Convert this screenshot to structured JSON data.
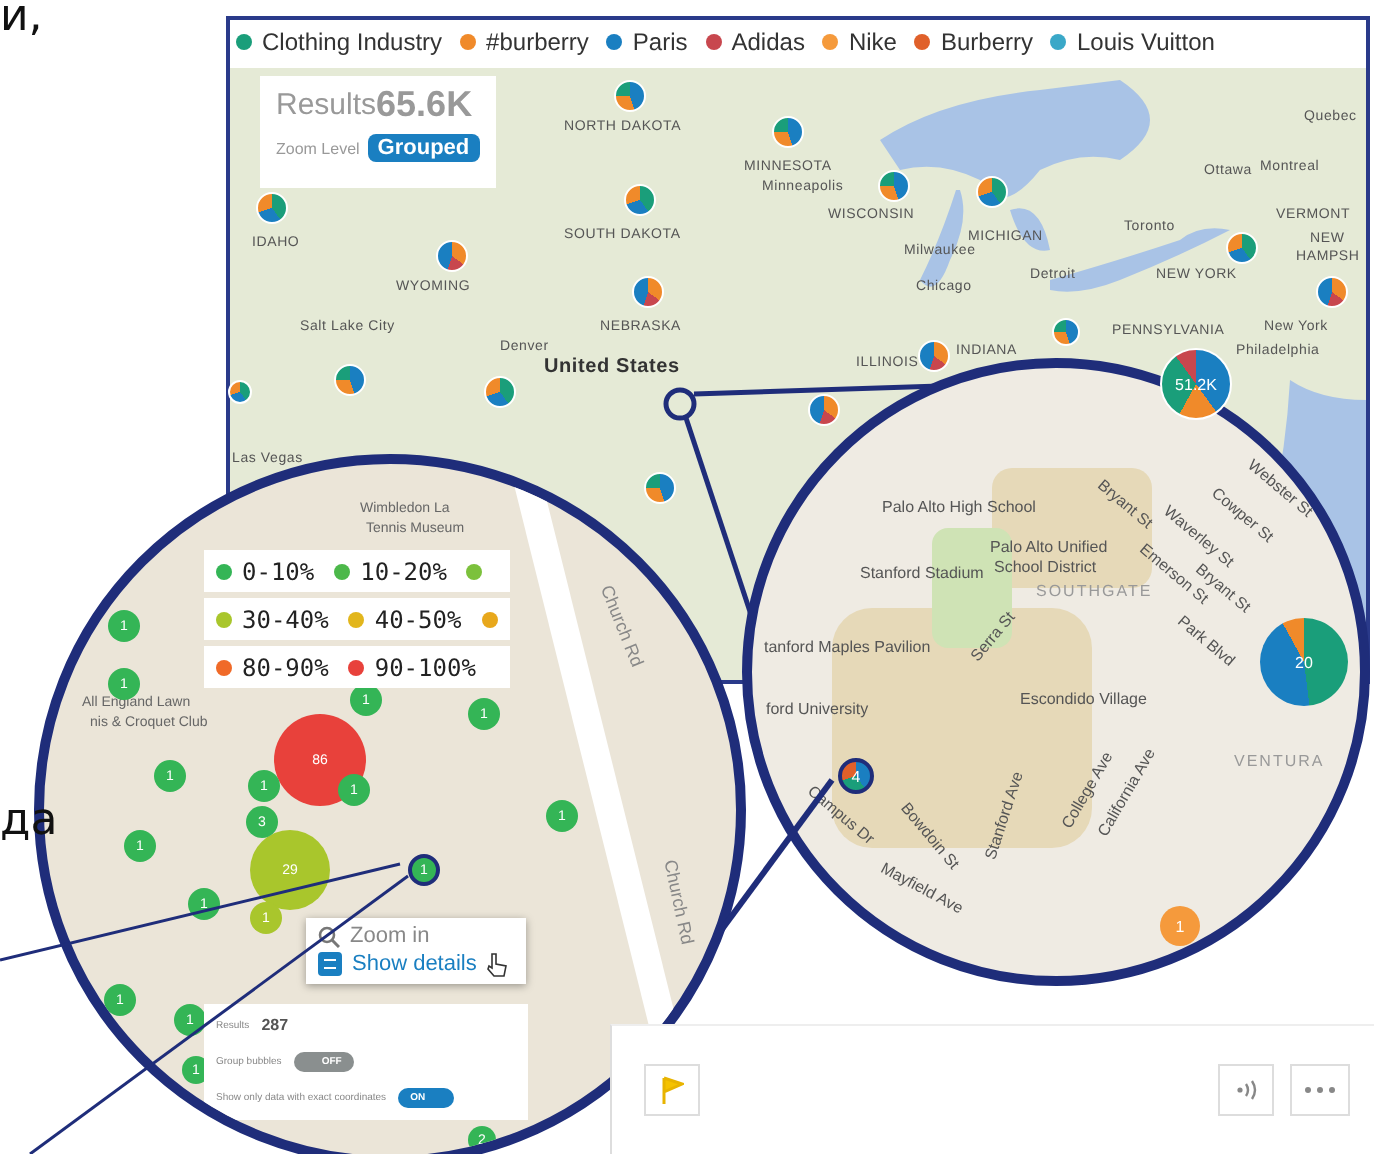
{
  "page_fragments": [
    "и,",
    "да"
  ],
  "legend": [
    {
      "label": "Clothing Industry",
      "color": "#1a9e7a"
    },
    {
      "label": "#burberry",
      "color": "#f08a2a"
    },
    {
      "label": "Paris",
      "color": "#1a7fc1"
    },
    {
      "label": "Adidas",
      "color": "#c8474e"
    },
    {
      "label": "Nike",
      "color": "#f59a3c"
    },
    {
      "label": "Burberry",
      "color": "#e0602a"
    },
    {
      "label": "Louis Vuitton",
      "color": "#3aa8c8"
    }
  ],
  "results": {
    "label": "Results",
    "value": "65.6K",
    "zoom_label": "Zoom Level",
    "zoom_value": "Grouped"
  },
  "map_labels": [
    "NORTH DAKOTA",
    "SOUTH DAKOTA",
    "NEBRASKA",
    "MINNESOTA",
    "Minneapolis",
    "IDAHO",
    "WYOMING",
    "Salt Lake City",
    "Denver",
    "United States",
    "Las Vegas",
    "WISCONSIN",
    "MICHIGAN",
    "Milwaukee",
    "Chicago",
    "Detroit",
    "ILLINOIS",
    "INDIANA",
    "Toronto",
    "Ottawa",
    "Montreal",
    "Quebec",
    "VERMONT",
    "NEW",
    "HAMPSH",
    "NEW YORK",
    "PENNSYLVANIA",
    "New York",
    "Philadelphia"
  ],
  "big_pin_label": "51.2K",
  "detail_map": {
    "place_labels": [
      "Wimbledon La",
      "Tennis Museum",
      "All England Lawn",
      "nis & Croquet Club",
      "Church Rd",
      "Church Rd"
    ],
    "legend_rows": [
      {
        "items": [
          {
            "label": "0-10%",
            "color": "#34b556"
          },
          {
            "label": "10-20%",
            "color": "#4cb84a"
          }
        ],
        "cut_dot": {
          "color": "#7cc13c"
        }
      },
      {
        "items": [
          {
            "label": "30-40%",
            "color": "#a9c62c"
          },
          {
            "label": "40-50%",
            "color": "#e2b61c"
          }
        ],
        "cut_dot": {
          "color": "#e8a81c"
        }
      },
      {
        "items": [
          {
            "label": "80-90%",
            "color": "#f06a28"
          },
          {
            "label": "90-100%",
            "color": "#e8413b"
          }
        ]
      }
    ],
    "bubbles": [
      {
        "label": "86",
        "color": "#e8413b"
      },
      {
        "label": "29",
        "color": "#a9c62c"
      },
      {
        "label": "1",
        "color": "#34b556"
      },
      {
        "label": "1",
        "color": "#34b556"
      },
      {
        "label": "1",
        "color": "#34b556"
      },
      {
        "label": "1",
        "color": "#34b556"
      },
      {
        "label": "1",
        "color": "#34b556"
      },
      {
        "label": "1",
        "color": "#34b556"
      },
      {
        "label": "1",
        "color": "#34b556"
      },
      {
        "label": "1",
        "color": "#34b556"
      },
      {
        "label": "1",
        "color": "#34b556"
      },
      {
        "label": "1",
        "color": "#34b556"
      },
      {
        "label": "1",
        "color": "#a9c62c"
      },
      {
        "label": "1",
        "color": "#34b556"
      },
      {
        "label": "1",
        "color": "#34b556"
      },
      {
        "label": "1",
        "color": "#34b556"
      },
      {
        "label": "3",
        "color": "#34b556"
      },
      {
        "label": "2",
        "color": "#34b556"
      },
      {
        "label": "1",
        "color": "#34b556"
      }
    ],
    "popup": {
      "zoom_in": "Zoom in",
      "show_details": "Show details"
    },
    "panel": {
      "results_label": "Results",
      "results_value": "287",
      "toggles": [
        {
          "label": "Group bubbles",
          "on": false,
          "state_text": "OFF"
        },
        {
          "label": "Show only data with exact coordinates",
          "on": true,
          "state_text": "ON"
        }
      ]
    }
  },
  "street_map": {
    "labels": [
      "Palo Alto High School",
      "Palo Alto Unified",
      "School District",
      "Stanford Stadium",
      "SOUTHGATE",
      "tanford Maples Pavilion",
      "Escondido Village",
      "VENTURA",
      "Bryant St",
      "Waverley St",
      "Cowper St",
      "Webster St",
      "Emerson St",
      "Bryant St",
      "Park Blvd",
      "Serra St",
      "ford University",
      "Bowdoin St",
      "Stanford Ave",
      "College Ave",
      "California Ave",
      "Mayfield Ave",
      "Campus Dr"
    ],
    "pins": [
      "20",
      "4",
      "1"
    ]
  }
}
